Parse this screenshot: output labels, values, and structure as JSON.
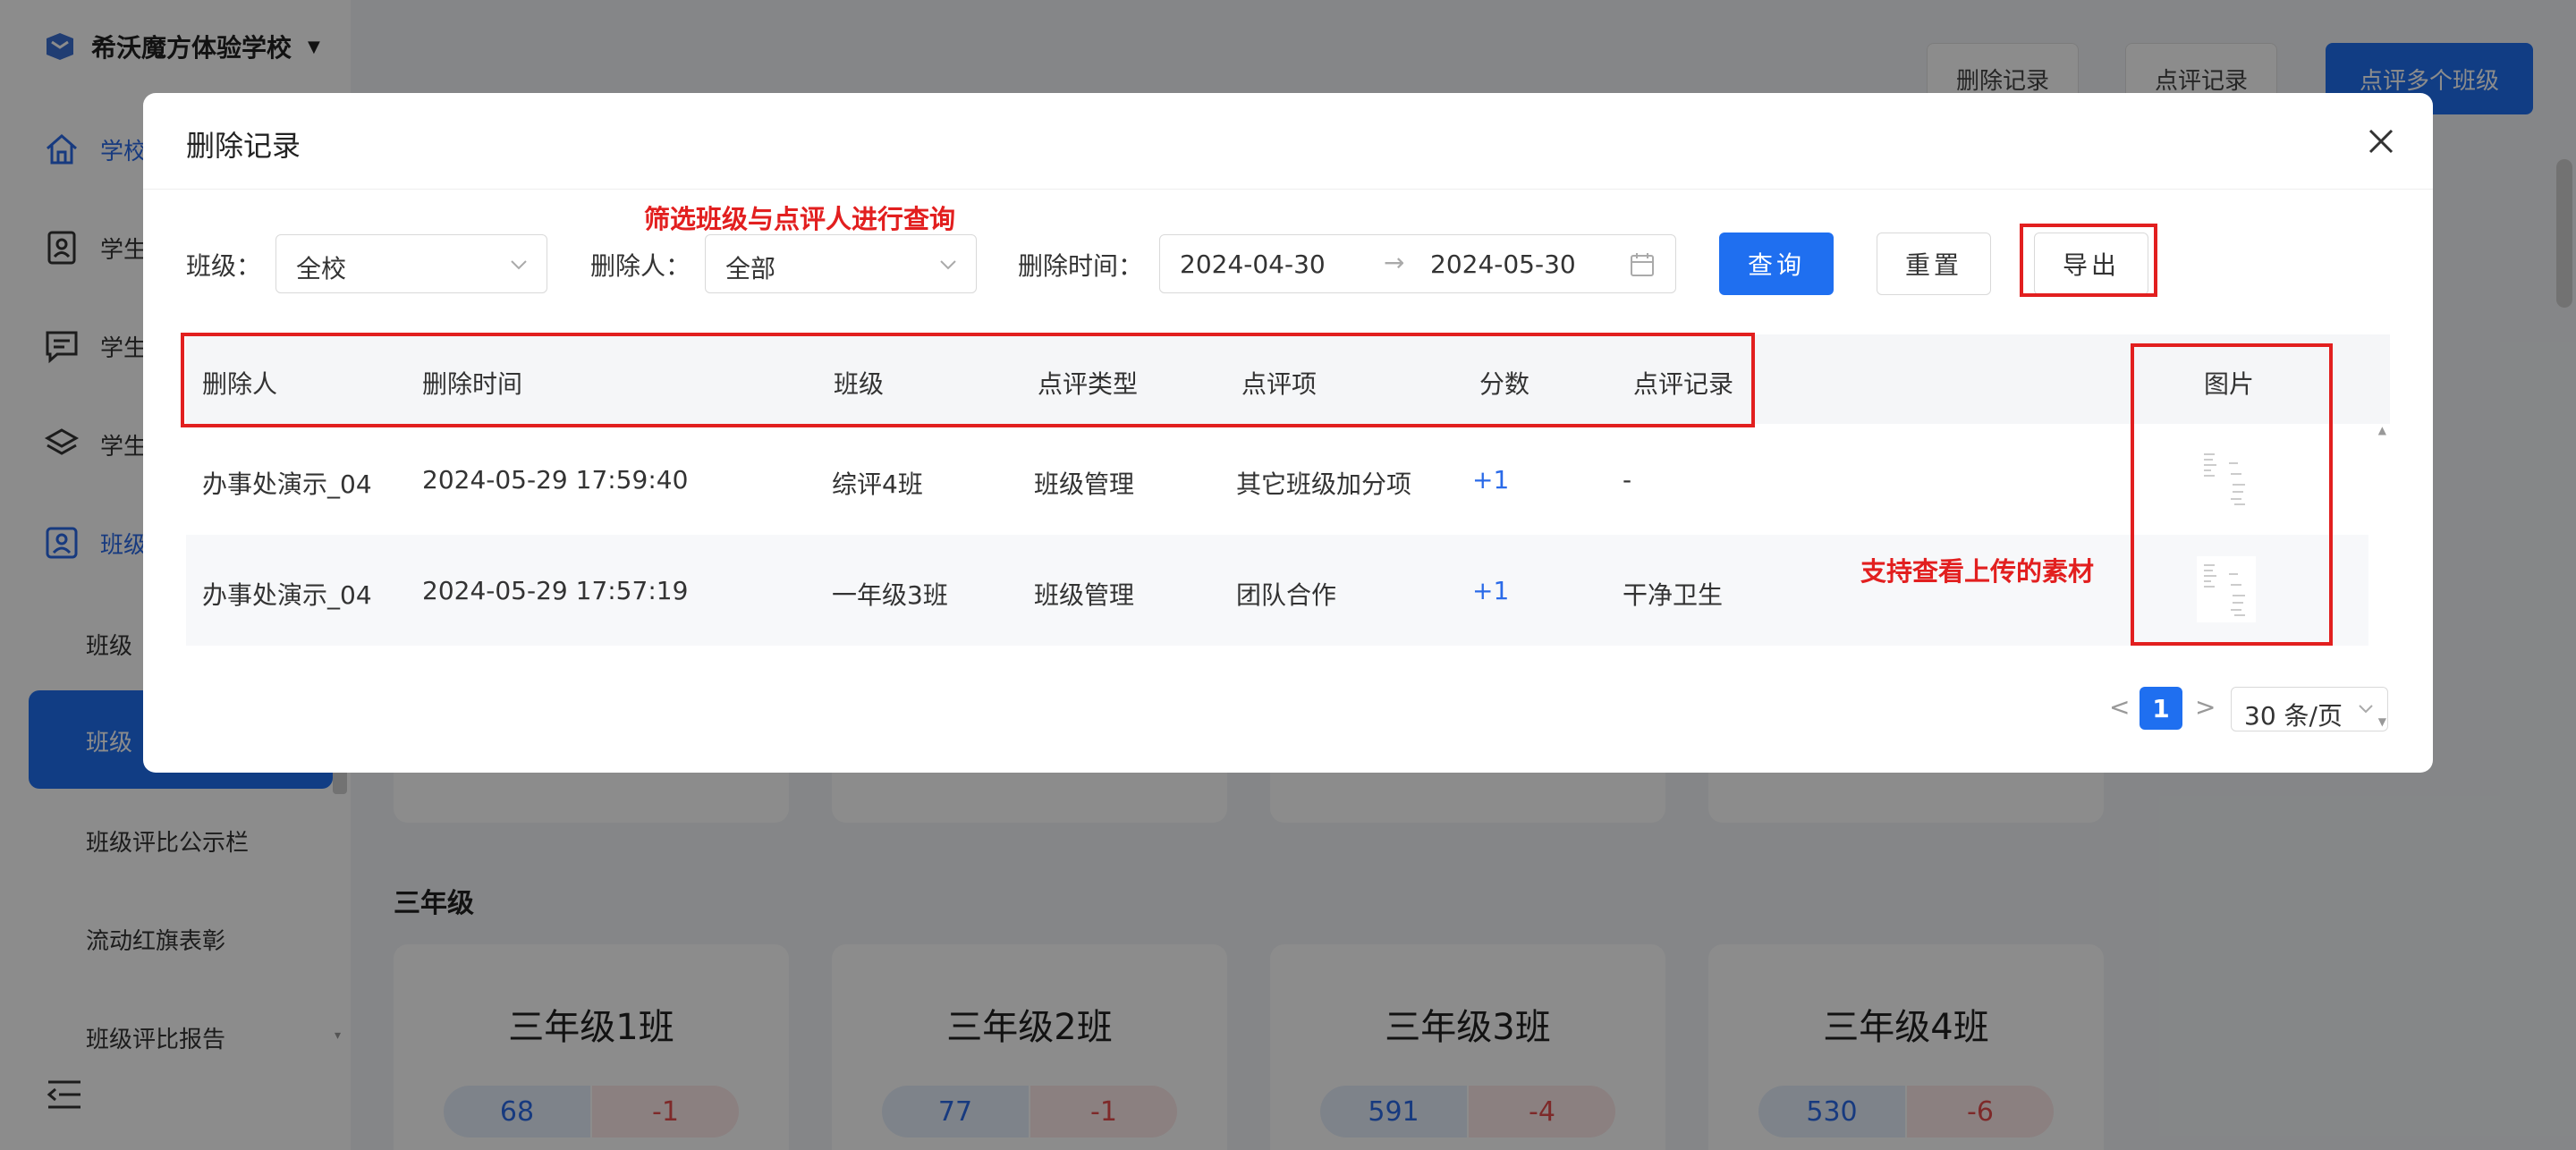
{
  "sidebar": {
    "school_name": "希沃魔方体验学校",
    "nav": [
      {
        "label": "学校",
        "icon": "home-icon"
      },
      {
        "label": "学生",
        "icon": "id-card-icon"
      },
      {
        "label": "学生",
        "icon": "comment-icon"
      },
      {
        "label": "学生",
        "icon": "layers-icon"
      },
      {
        "label": "班级",
        "icon": "class-icon"
      }
    ],
    "sub_items": [
      "班级",
      "班级",
      "班级评比公示栏",
      "流动红旗表彰",
      "班级评比报告"
    ]
  },
  "topbar": {
    "delete_records": "删除记录",
    "review_records": "点评记录",
    "review_multiple": "点评多个班级"
  },
  "grade": {
    "title": "三年级",
    "cards": [
      {
        "name": "三年级1班",
        "pos": "68",
        "neg": "-1"
      },
      {
        "name": "三年级2班",
        "pos": "77",
        "neg": "-1"
      },
      {
        "name": "三年级3班",
        "pos": "591",
        "neg": "-4"
      },
      {
        "name": "三年级4班",
        "pos": "530",
        "neg": "-6"
      }
    ]
  },
  "modal": {
    "title": "删除记录",
    "filters": {
      "class_label": "班级：",
      "class_value": "全校",
      "deleter_label": "删除人：",
      "deleter_value": "全部",
      "time_label": "删除时间：",
      "date_start": "2024-04-30",
      "date_end": "2024-05-30",
      "arrow": "→",
      "query": "查询",
      "reset": "重置",
      "export": "导出"
    },
    "columns": [
      "删除人",
      "删除时间",
      "班级",
      "点评类型",
      "点评项",
      "分数",
      "点评记录",
      "图片"
    ],
    "rows": [
      {
        "deleter": "办事处演示_04",
        "time": "2024-05-29 17:59:40",
        "class": "综评4班",
        "type": "班级管理",
        "item": "其它班级加分项",
        "score": "+1",
        "record": "-"
      },
      {
        "deleter": "办事处演示_04",
        "time": "2024-05-29 17:57:19",
        "class": "一年级3班",
        "type": "班级管理",
        "item": "团队合作",
        "score": "+1",
        "record": "干净卫生"
      }
    ],
    "pagination": {
      "prev": "<",
      "current": "1",
      "next": ">",
      "page_size": "30 条/页"
    }
  },
  "annotations": {
    "filter_note": "筛选班级与点评人进行查询",
    "material_note": "支持查看上传的素材"
  },
  "colors": {
    "primary": "#1f6ff0",
    "annotation": "#e21f1f",
    "positive": "#2a6ae8",
    "negative": "#e64c4c"
  }
}
